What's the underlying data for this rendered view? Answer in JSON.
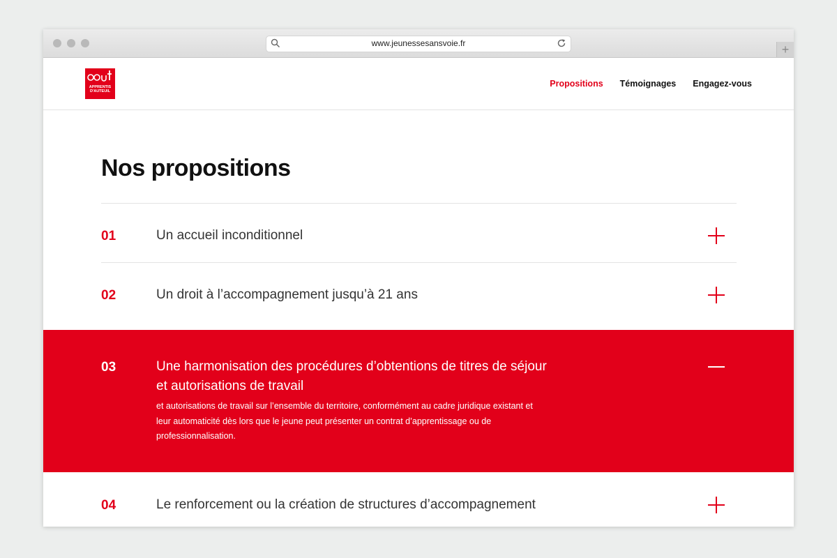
{
  "browser": {
    "url": "www.jeunessesansvoie.fr"
  },
  "header": {
    "logo_text_line1": "APPRENTIS",
    "logo_text_line2": "D'AUTEUIL",
    "nav": [
      {
        "label": "Propositions"
      },
      {
        "label": "Témoignages"
      },
      {
        "label": "Engagez-vous"
      }
    ],
    "accent_color": "#e2001a"
  },
  "main": {
    "title": "Nos propositions",
    "items": [
      {
        "number": "01",
        "title": "Un accueil inconditionnel",
        "expanded": false
      },
      {
        "number": "02",
        "title": "Un droit à l’accompagnement jusqu’à 21 ans",
        "expanded": false
      },
      {
        "number": "03",
        "title": "Une harmonisation des procédures  d’obtentions de titres de séjour et autorisations de travail",
        "description": "et autorisations de travail sur l’ensemble du territoire, conformément au cadre juridique existant et leur automaticité dès lors que le jeune peut présenter un contrat d’apprentissage ou de professionnalisation.",
        "expanded": true
      },
      {
        "number": "04",
        "title": "Le renforcement ou la création de structures d’accompagnement",
        "expanded": false
      }
    ]
  }
}
